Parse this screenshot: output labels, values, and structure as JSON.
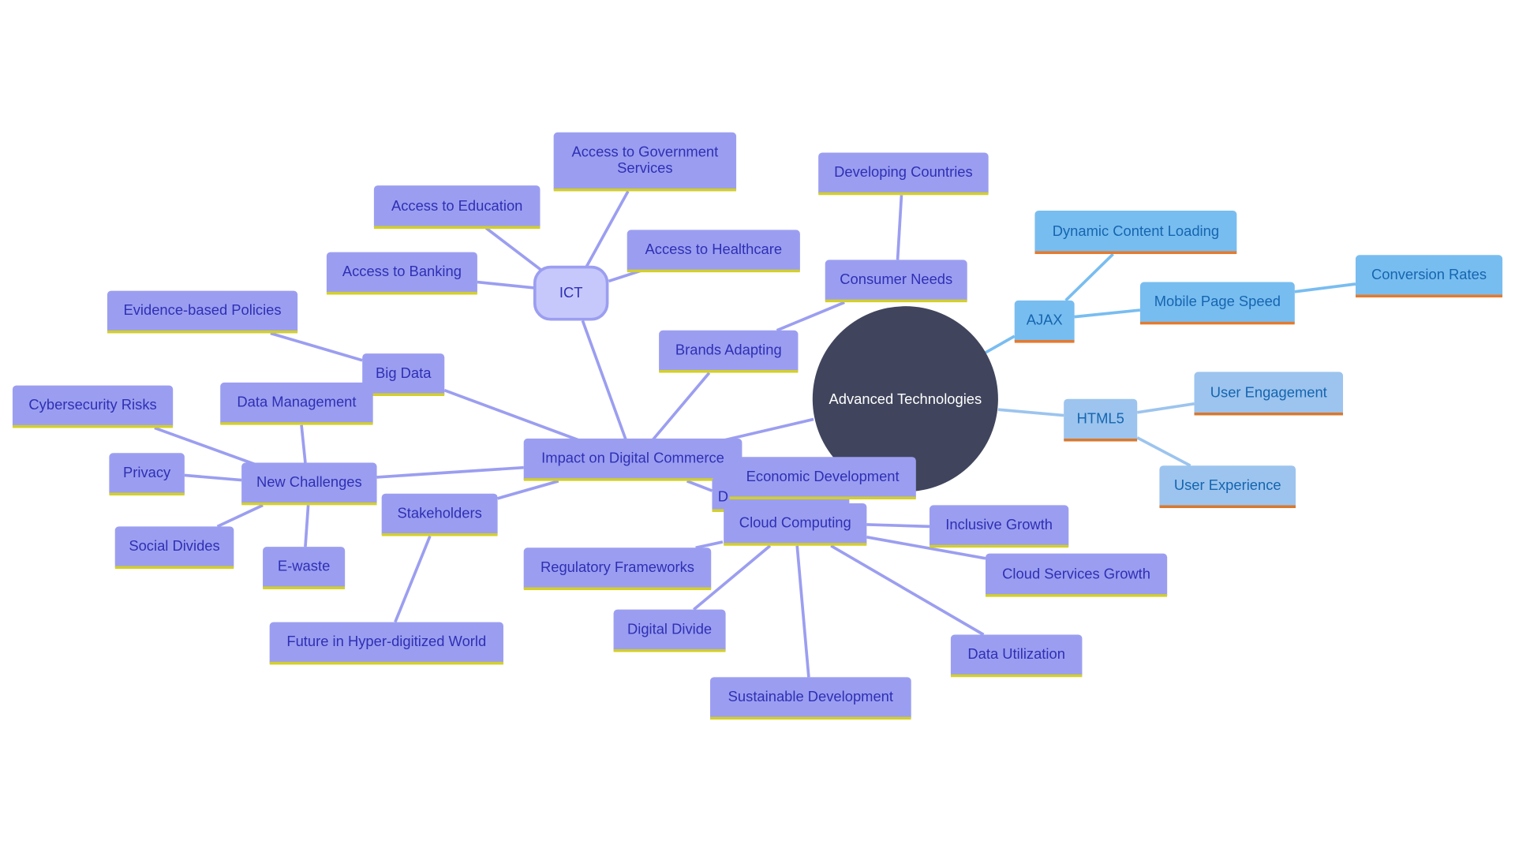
{
  "root": "Advanced Technologies",
  "colors": {
    "primary_node": "#9b9ef0",
    "primary_text": "#2f2fb5",
    "primary_underline": "#d3cf2a",
    "ajax_node": "#78bdf0",
    "html5_node": "#9cc4ee",
    "blue_underline": "#e57a2e",
    "root_fill": "#40455d"
  },
  "nodes": {
    "ict": "ICT",
    "gov": "Access to Government Services",
    "education": "Access to Education",
    "healthcare": "Access to Healthcare",
    "banking": "Access to Banking",
    "developing": "Developing Countries",
    "consumer": "Consumer Needs",
    "brands": "Brands Adapting",
    "dynamic": "Dynamic Content Loading",
    "ajax": "AJAX",
    "mobile": "Mobile Page Speed",
    "conversion": "Conversion Rates",
    "html5": "HTML5",
    "engagement": "User Engagement",
    "experience": "User Experience",
    "evidence": "Evidence-based Policies",
    "bigdata": "Big Data",
    "datamgmt": "Data Management",
    "cyber": "Cybersecurity Risks",
    "privacy": "Privacy",
    "newchallenges": "New Challenges",
    "social": "Social Divides",
    "ewaste": "E-waste",
    "stakeholders": "Stakeholders",
    "future": "Future in Hyper-digitized World",
    "impact": "Impact on Digital Commerce",
    "hidden": "D",
    "economic": "Economic Development",
    "cloud": "Cloud Computing",
    "inclusive": "Inclusive Growth",
    "cloudgrowth": "Cloud Services Growth",
    "regulatory": "Regulatory Frameworks",
    "divide": "Digital Divide",
    "datautil": "Data Utilization",
    "sustainable": "Sustainable Development"
  }
}
